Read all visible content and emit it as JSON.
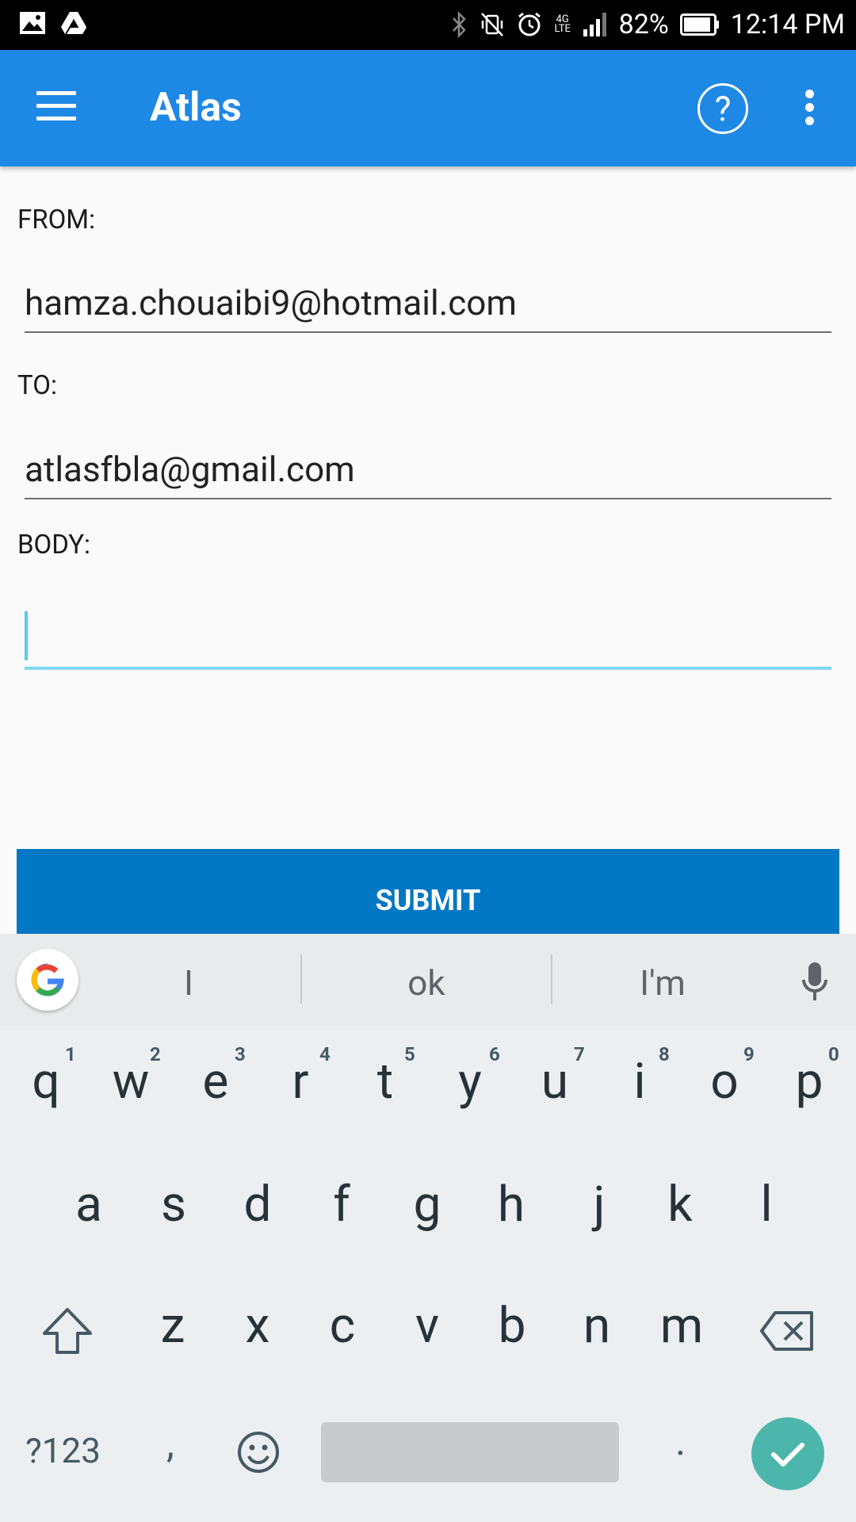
{
  "status_bar": {
    "battery": "82%",
    "time": "12:14 PM",
    "network": "4G LTE"
  },
  "app_bar": {
    "title": "Atlas"
  },
  "form": {
    "from_label": "FROM:",
    "from_value": "hamza.chouaibi9@hotmail.com",
    "to_label": "TO:",
    "to_value": "atlasfbla@gmail.com",
    "body_label": "BODY:",
    "body_value": "",
    "submit_label": "SUBMIT"
  },
  "keyboard": {
    "suggestions": [
      "I",
      "ok",
      "I'm"
    ],
    "row1": [
      "q",
      "w",
      "e",
      "r",
      "t",
      "y",
      "u",
      "i",
      "o",
      "p"
    ],
    "row1_hints": [
      "1",
      "2",
      "3",
      "4",
      "5",
      "6",
      "7",
      "8",
      "9",
      "0"
    ],
    "row2": [
      "a",
      "s",
      "d",
      "f",
      "g",
      "h",
      "j",
      "k",
      "l"
    ],
    "row3": [
      "z",
      "x",
      "c",
      "v",
      "b",
      "n",
      "m"
    ],
    "symbols_key": "?123",
    "comma_key": ",",
    "period_key": ".",
    "accent_color": "#4db6ac"
  },
  "colors": {
    "app_bar": "#1e88e5",
    "submit": "#0277c4",
    "focus_underline": "#80d8f0"
  }
}
